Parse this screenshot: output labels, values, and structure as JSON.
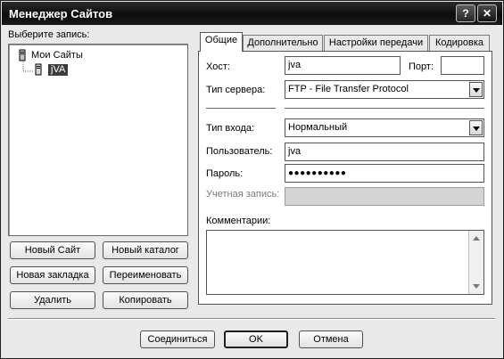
{
  "window": {
    "title": "Менеджер Сайтов",
    "help_glyph": "?",
    "close_glyph": "✕"
  },
  "left": {
    "label": "Выберите запись:",
    "tree": {
      "root": "Мои Сайты",
      "child": "jVA"
    },
    "buttons": {
      "new_site": "Новый Сайт",
      "new_folder": "Новый каталог",
      "new_bookmark": "Новая закладка",
      "rename": "Переименовать",
      "delete": "Удалить",
      "copy": "Копировать"
    }
  },
  "tabs": [
    "Общие",
    "Дополнительно",
    "Настройки передачи",
    "Кодировка"
  ],
  "general": {
    "host_label": "Хост:",
    "host_value": "jva",
    "port_label": "Порт:",
    "port_value": "",
    "server_type_label": "Тип сервера:",
    "server_type_value": "FTP - File Transfer Protocol",
    "logon_type_label": "Тип входа:",
    "logon_type_value": "Нормальный",
    "user_label": "Пользователь:",
    "user_value": "jva",
    "password_label": "Пароль:",
    "password_value": "●●●●●●●●●●",
    "account_label": "Учетная запись:",
    "account_value": "",
    "comments_label": "Комментарии:",
    "comments_value": ""
  },
  "footer": {
    "connect": "Соединиться",
    "ok": "OK",
    "cancel": "Отмена"
  }
}
